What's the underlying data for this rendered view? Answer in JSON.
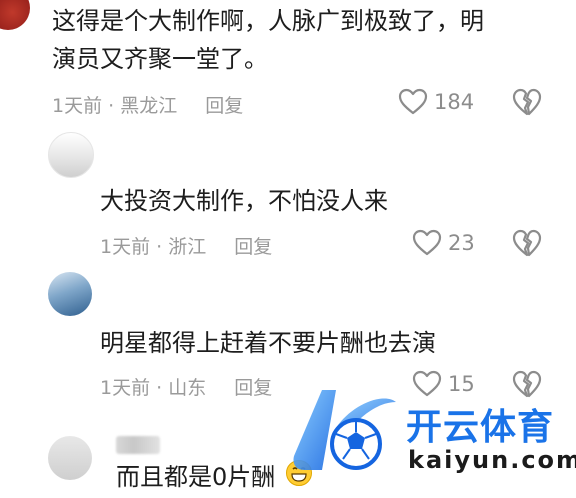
{
  "comments": [
    {
      "text_line1": "这得是个大制作啊，人脉广到极致了，明",
      "text_line2": "演员又齐聚一堂了。",
      "meta": "1天前 · 黑龙江",
      "reply": "回复",
      "likes": "184"
    },
    {
      "text": "大投资大制作，不怕没人来",
      "meta": "1天前 · 浙江",
      "reply": "回复",
      "likes": "23"
    },
    {
      "text": "明星都得上赶着不要片酬也去演",
      "meta": "1天前 · 山东",
      "reply": "回复",
      "likes": "15"
    },
    {
      "text": "而且都是0片酬",
      "emoji": "grinning-face"
    }
  ],
  "watermark": {
    "brand": "开云体育",
    "url": "kaiyun.com",
    "colors": {
      "brand": "#1a73e8",
      "text": "#1b1b1b"
    }
  },
  "colors": {
    "meta": "#9a9a9a",
    "text": "#1d1d1d",
    "icon": "#8c8c8c"
  }
}
